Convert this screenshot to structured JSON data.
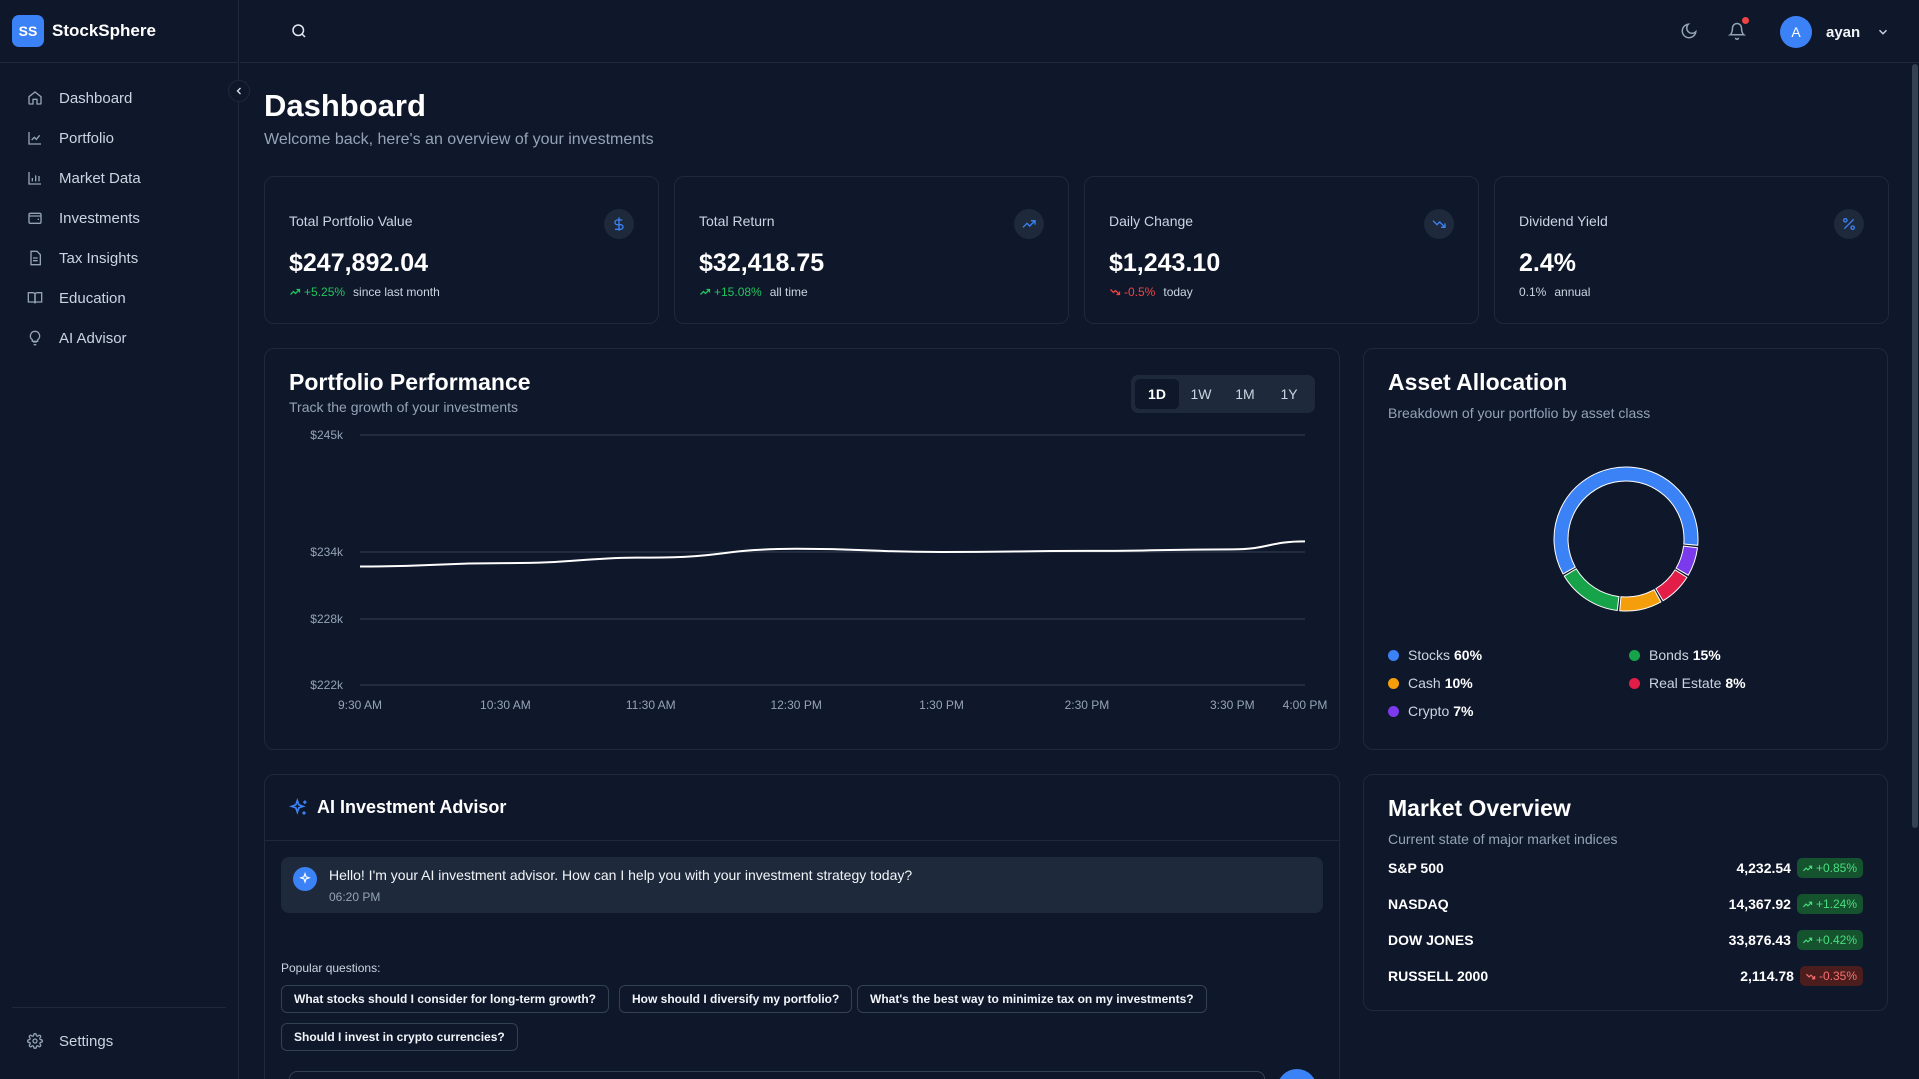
{
  "app": {
    "logo_initials": "SS",
    "name": "StockSphere"
  },
  "sidebar": {
    "items": [
      {
        "label": "Dashboard",
        "icon": "home-icon"
      },
      {
        "label": "Portfolio",
        "icon": "line-chart-icon"
      },
      {
        "label": "Market Data",
        "icon": "bar-chart-icon"
      },
      {
        "label": "Investments",
        "icon": "wallet-icon"
      },
      {
        "label": "Tax Insights",
        "icon": "document-icon"
      },
      {
        "label": "Education",
        "icon": "book-icon"
      },
      {
        "label": "AI Advisor",
        "icon": "lightbulb-icon"
      }
    ],
    "settings_label": "Settings"
  },
  "header": {
    "user_initial": "A",
    "username": "ayan",
    "has_notification": true
  },
  "page": {
    "title": "Dashboard",
    "subtitle": "Welcome back, here's an overview of your investments"
  },
  "stats": [
    {
      "title": "Total Portfolio Value",
      "value": "$247,892.04",
      "change": "+5.25%",
      "trend": "up",
      "period": "since last month",
      "icon": "dollar-icon"
    },
    {
      "title": "Total Return",
      "value": "$32,418.75",
      "change": "+15.08%",
      "trend": "up",
      "period": "all time",
      "icon": "trending-up-icon"
    },
    {
      "title": "Daily Change",
      "value": "$1,243.10",
      "change": "-0.5%",
      "trend": "down",
      "period": "today",
      "icon": "trending-down-icon"
    },
    {
      "title": "Dividend Yield",
      "value": "2.4%",
      "change": "0.1%",
      "trend": "neutral",
      "period": "annual",
      "icon": "percent-icon"
    }
  ],
  "performance": {
    "title": "Portfolio Performance",
    "subtitle": "Track the growth of your investments",
    "ranges": [
      "1D",
      "1W",
      "1M",
      "1Y"
    ],
    "active_range": "1D"
  },
  "chart_data": {
    "type": "line",
    "x": [
      "9:30 AM",
      "10:30 AM",
      "11:30 AM",
      "12:30 PM",
      "1:30 PM",
      "2:30 PM",
      "3:30 PM",
      "4:00 PM"
    ],
    "values": [
      232700,
      233000,
      233500,
      234300,
      234000,
      234100,
      234250,
      235000
    ],
    "yticks": [
      "$245k",
      "$234k",
      "$228k",
      "$222k"
    ],
    "ytick_values": [
      245000,
      234000,
      228000,
      222000
    ],
    "ylim": [
      222000,
      245000
    ],
    "grid": true,
    "line_color": "#ffffff"
  },
  "allocation": {
    "title": "Asset Allocation",
    "subtitle": "Breakdown of your portfolio by asset class",
    "slices": [
      {
        "label": "Stocks",
        "percent": "60%",
        "value": 60,
        "color": "#3b82f6"
      },
      {
        "label": "Crypto",
        "percent": "7%",
        "value": 7,
        "color": "#7c3aed"
      },
      {
        "label": "Real Estate",
        "percent": "8%",
        "value": 8,
        "color": "#e11d48"
      },
      {
        "label": "Cash",
        "percent": "10%",
        "value": 10,
        "color": "#f59e0b"
      },
      {
        "label": "Bonds",
        "percent": "15%",
        "value": 15,
        "color": "#16a34a"
      }
    ]
  },
  "advisor": {
    "title": "AI Investment Advisor",
    "message": "Hello! I'm your AI investment advisor. How can I help you with your investment strategy today?",
    "time": "06:20 PM",
    "popular_label": "Popular questions:",
    "questions": [
      "What stocks should I consider for long-term growth?",
      "How should I diversify my portfolio?",
      "What's the best way to minimize tax on my investments?",
      "Should I invest in crypto currencies?"
    ]
  },
  "market": {
    "title": "Market Overview",
    "subtitle": "Current state of major market indices",
    "rows": [
      {
        "name": "S&P 500",
        "value": "4,232.54",
        "change": "+0.85%",
        "trend": "up"
      },
      {
        "name": "NASDAQ",
        "value": "14,367.92",
        "change": "+1.24%",
        "trend": "up"
      },
      {
        "name": "DOW JONES",
        "value": "33,876.43",
        "change": "+0.42%",
        "trend": "up"
      },
      {
        "name": "RUSSELL 2000",
        "value": "2,114.78",
        "change": "-0.35%",
        "trend": "down"
      }
    ]
  }
}
